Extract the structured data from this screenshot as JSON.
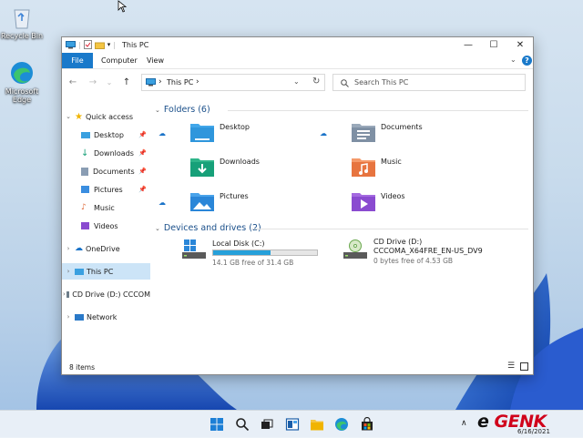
{
  "desktop": {
    "icons": [
      {
        "name": "recycle-bin",
        "label": "Recycle Bin"
      },
      {
        "name": "microsoft-edge",
        "label": "Microsoft Edge"
      }
    ]
  },
  "window": {
    "title": "This PC",
    "controls": {
      "minimize": "—",
      "maximize": "☐",
      "close": "✕"
    },
    "ribbon_tabs": [
      "File",
      "Computer",
      "View"
    ],
    "help_icon": "?",
    "nav_buttons": {
      "back": "←",
      "forward": "→",
      "recent": "⌄",
      "up": "↑"
    },
    "address": {
      "path": "This PC",
      "separator": "›"
    },
    "search": {
      "placeholder": "Search This PC"
    },
    "nav_pane": {
      "quick_access": "Quick access",
      "items": [
        {
          "label": "Desktop",
          "icon": "desktop-icon",
          "pinned": true
        },
        {
          "label": "Downloads",
          "icon": "downloads-icon",
          "pinned": true
        },
        {
          "label": "Documents",
          "icon": "documents-icon",
          "pinned": true
        },
        {
          "label": "Pictures",
          "icon": "pictures-icon",
          "pinned": true
        },
        {
          "label": "Music",
          "icon": "music-icon",
          "pinned": false
        },
        {
          "label": "Videos",
          "icon": "videos-icon",
          "pinned": false
        }
      ],
      "onedrive": "OneDrive",
      "this_pc": "This PC",
      "cd_drive": "CD Drive (D:) CCCOM",
      "network": "Network"
    },
    "folders_group": "Folders (6)",
    "folders": [
      {
        "label": "Desktop",
        "icon": "desktop-folder-icon",
        "cloud": true
      },
      {
        "label": "Documents",
        "icon": "documents-folder-icon",
        "cloud": true
      },
      {
        "label": "Downloads",
        "icon": "downloads-folder-icon",
        "cloud": false
      },
      {
        "label": "Music",
        "icon": "music-folder-icon",
        "cloud": false
      },
      {
        "label": "Pictures",
        "icon": "pictures-folder-icon",
        "cloud": true
      },
      {
        "label": "Videos",
        "icon": "videos-folder-icon",
        "cloud": false
      }
    ],
    "drives_group": "Devices and drives (2)",
    "drives": [
      {
        "label": "Local Disk (C:)",
        "free": "14.1 GB free of 31.4 GB",
        "used_fraction": 0.55
      },
      {
        "label": "CD Drive (D:)",
        "sublabel": "CCCOMA_X64FRE_EN-US_DV9",
        "free": "0 bytes free of 4.53 GB"
      }
    ],
    "status": {
      "count": "8 items"
    }
  },
  "taskbar": {
    "icons": [
      "start-icon",
      "search-icon",
      "task-view-icon",
      "widgets-icon",
      "file-explorer-icon",
      "edge-icon",
      "store-icon"
    ],
    "tray_chevron": "∧",
    "watermark": "GENK",
    "time": "6/16/2021"
  },
  "colors": {
    "accent": "#1979ca",
    "selected": "#cce4f7",
    "bar_fill": "#26a0da",
    "watermark_red": "#d0021b"
  }
}
